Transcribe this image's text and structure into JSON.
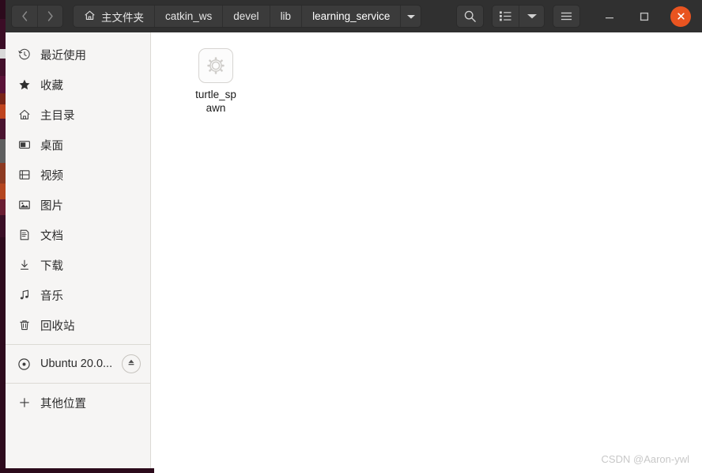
{
  "window": {
    "titlebar_bg": "#303030",
    "accent": "#e95420"
  },
  "header": {
    "nav": [
      {
        "name": "back",
        "label": "‹",
        "enabled": false
      },
      {
        "name": "forward",
        "label": "›",
        "enabled": false
      }
    ],
    "breadcrumbs": [
      {
        "label": "主文件夹",
        "icon": "home-icon",
        "current": false
      },
      {
        "label": "catkin_ws",
        "icon": "",
        "current": false
      },
      {
        "label": "devel",
        "icon": "",
        "current": false
      },
      {
        "label": "lib",
        "icon": "",
        "current": false
      },
      {
        "label": "learning_service",
        "icon": "",
        "current": true
      }
    ],
    "breadcrumb_dropdown": "chevron-down-icon",
    "tools": {
      "search": "search-icon",
      "view_list": "list-view-icon",
      "view_dropdown": "chevron-down-icon",
      "menu": "hamburger-menu-icon"
    },
    "window_controls": {
      "minimize": "–",
      "maximize": "□",
      "close": "✕"
    }
  },
  "sidebar": {
    "items": [
      {
        "label": "最近使用",
        "icon": "clock-icon"
      },
      {
        "label": "收藏",
        "icon": "star-icon"
      },
      {
        "label": "主目录",
        "icon": "home-icon"
      },
      {
        "label": "桌面",
        "icon": "desktop-icon"
      },
      {
        "label": "视频",
        "icon": "video-icon"
      },
      {
        "label": "图片",
        "icon": "image-icon"
      },
      {
        "label": "文档",
        "icon": "document-icon"
      },
      {
        "label": "下载",
        "icon": "download-icon"
      },
      {
        "label": "音乐",
        "icon": "music-icon"
      },
      {
        "label": "回收站",
        "icon": "trash-icon"
      }
    ],
    "devices": [
      {
        "label": "Ubuntu 20.0...",
        "icon": "disc-icon",
        "eject": "eject-icon"
      }
    ],
    "other": [
      {
        "label": "其他位置",
        "icon": "plus-icon"
      }
    ]
  },
  "main": {
    "files": [
      {
        "name": "turtle_spawn",
        "icon": "gear-executable-icon",
        "line1": "turtle_",
        "line2": "spawn"
      }
    ]
  },
  "watermark": {
    "text": "CSDN @Aaron-ywl"
  }
}
